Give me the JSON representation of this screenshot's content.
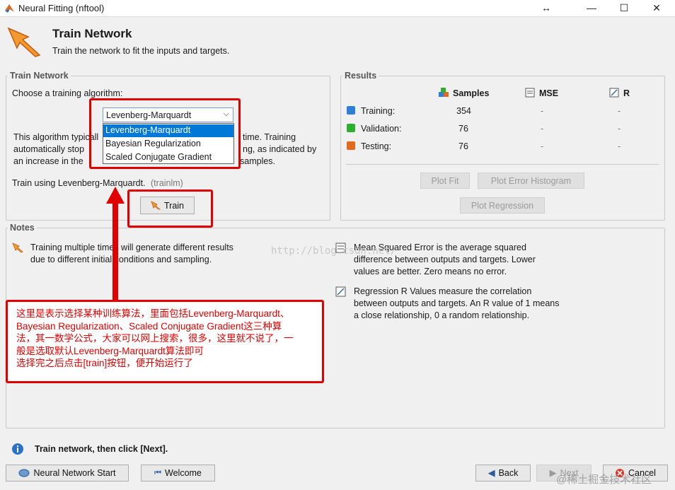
{
  "window": {
    "title": "Neural Fitting (nftool)",
    "resize_glyph": "↔",
    "min": "—",
    "max": "☐",
    "close": "✕"
  },
  "header": {
    "title": "Train Network",
    "subtitle": "Train the network to fit the inputs and targets."
  },
  "train_panel": {
    "label": "Train Network",
    "choose_label": "Choose a training algorithm:",
    "select_value": "Levenberg-Marquardt",
    "options": [
      "Levenberg-Marquardt",
      "Bayesian Regularization",
      "Scaled Conjugate Gradient"
    ],
    "desc_line1a": "This algorithm typicall",
    "desc_line1b": "time. Training",
    "desc_line2a": "automatically stop",
    "desc_line2b": "ng, as indicated by",
    "desc_line3a": "an increase in the",
    "desc_line3b": "samples.",
    "train_using": "Train using Levenberg-Marquardt.",
    "train_using_fn": "(trainlm)",
    "train_button": "Train"
  },
  "results": {
    "label": "Results",
    "col_samples": "Samples",
    "col_mse": "MSE",
    "col_r": "R",
    "rows": [
      {
        "name": "Training:",
        "samples": "354",
        "mse": "-",
        "r": "-",
        "color": "#2f7fd8"
      },
      {
        "name": "Validation:",
        "samples": "76",
        "mse": "-",
        "r": "-",
        "color": "#2fae2f"
      },
      {
        "name": "Testing:",
        "samples": "76",
        "mse": "-",
        "r": "-",
        "color": "#e06a1e"
      }
    ],
    "plot_fit": "Plot Fit",
    "plot_error_histogram": "Plot Error Histogram",
    "plot_regression": "Plot Regression"
  },
  "notes": {
    "label": "Notes",
    "left_line1": "Training multiple times will generate different results",
    "left_line2": "due to different initial conditions and sampling.",
    "mse_line1": "Mean Squared Error is the average squared",
    "mse_line2": "difference between outputs and targets. Lower",
    "mse_line3": "values are better. Zero means no error.",
    "r_line1": "Regression R Values measure the correlation",
    "r_line2": "between outputs and targets. An R value of 1 means",
    "r_line3": "a close relationship, 0 a random relationship."
  },
  "annotation": {
    "line1": "这里是表示选择某种训练算法，里面包括Levenberg-Marquardt、",
    "line2": "Bayesian Regularization、Scaled Conjugate Gradient这三种算",
    "line3": "法，其一数学公式，大家可以网上搜索，很多，这里就不说了，一",
    "line4": "般是选取默认Levenberg-Marquardt算法即可",
    "line5": "选择完之后点击[train]按钮，便开始运行了"
  },
  "watermark": "http://blog.csdn.net/",
  "status": {
    "text": "Train network, then click [Next]."
  },
  "footer": {
    "nn_start": "Neural Network Start",
    "welcome": "Welcome",
    "back": "Back",
    "next": "Next",
    "cancel": "Cancel"
  },
  "corner_watermark": "@稀土掘金技术社区"
}
